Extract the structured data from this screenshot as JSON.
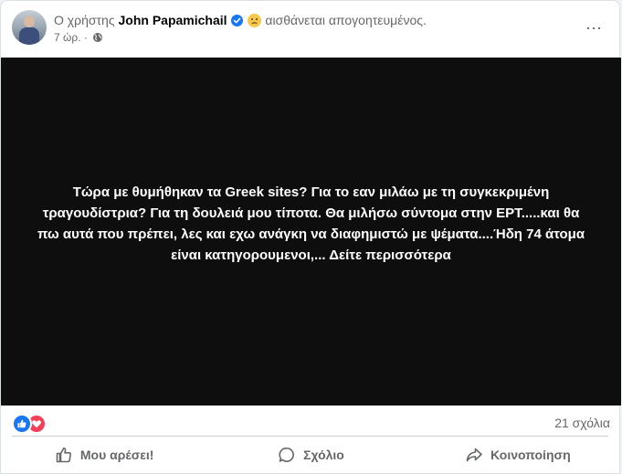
{
  "post": {
    "header": {
      "prefix": "Ο χρήστης",
      "user_name": "John Papamichail",
      "feeling": "αισθάνεται απογοητευμένος.",
      "time": "7 ώρ.",
      "separator": "·",
      "more_icon": "⋯"
    },
    "body": {
      "text": "Τώρα με θυμήθηκαν τα Greek sites? Για το εαν μιλάω με τη συγκεκριμένη τραγουδίστρια? Για τη δουλειά μου τίποτα. Θα μιλήσω σύντομα στην ΕΡΤ.....και θα πω αυτά που πρέπει, λες και εχω ανάγκη να διαφημιστώ με ψέματα....Ήδη 74 άτομα είναι κατηγορουμενοι,...",
      "see_more": "Δείτε περισσότερα"
    },
    "stats": {
      "comments": "21 σχόλια"
    },
    "actions": {
      "like": "Μου αρέσει!",
      "comment": "Σχόλιο",
      "share": "Κοινοποίηση"
    }
  },
  "colors": {
    "accent": "#1877f2",
    "love": "#f33e58",
    "post_background": "#0e0e0e",
    "secondary_text": "#65676b"
  },
  "icons": [
    "verified-badge-icon",
    "disappointed-face-icon",
    "globe-icon",
    "more-options-icon",
    "like-reaction-icon",
    "love-reaction-icon",
    "thumbs-up-icon",
    "comment-icon",
    "share-icon"
  ]
}
